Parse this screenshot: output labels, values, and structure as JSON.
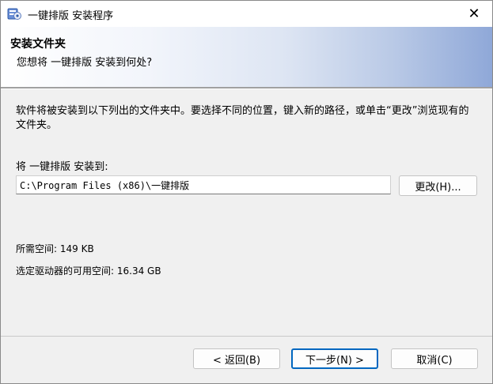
{
  "window": {
    "title": "一键排版 安装程序",
    "close_glyph": "✕"
  },
  "banner": {
    "heading": "安装文件夹",
    "subheading": "您想将 一键排版 安装到何处?"
  },
  "content": {
    "description": "软件将被安装到以下列出的文件夹中。要选择不同的位置，键入新的路径，或单击“更改”浏览现有的文件夹。",
    "install_to_label": "将 一键排版 安装到:",
    "install_path": "C:\\Program Files (x86)\\一键排版",
    "change_button": "更改(H)...",
    "required_space": "所需空间: 149 KB",
    "available_space": "选定驱动器的可用空间: 16.34 GB"
  },
  "footer": {
    "back_button": "< 返回(B)",
    "next_button": "下一步(N) >",
    "cancel_button": "取消(C)"
  },
  "colors": {
    "accent": "#0067c0",
    "banner_gradient_end": "#8fa8d8"
  },
  "icons": {
    "app": "installer-app-icon",
    "close": "close-icon"
  }
}
